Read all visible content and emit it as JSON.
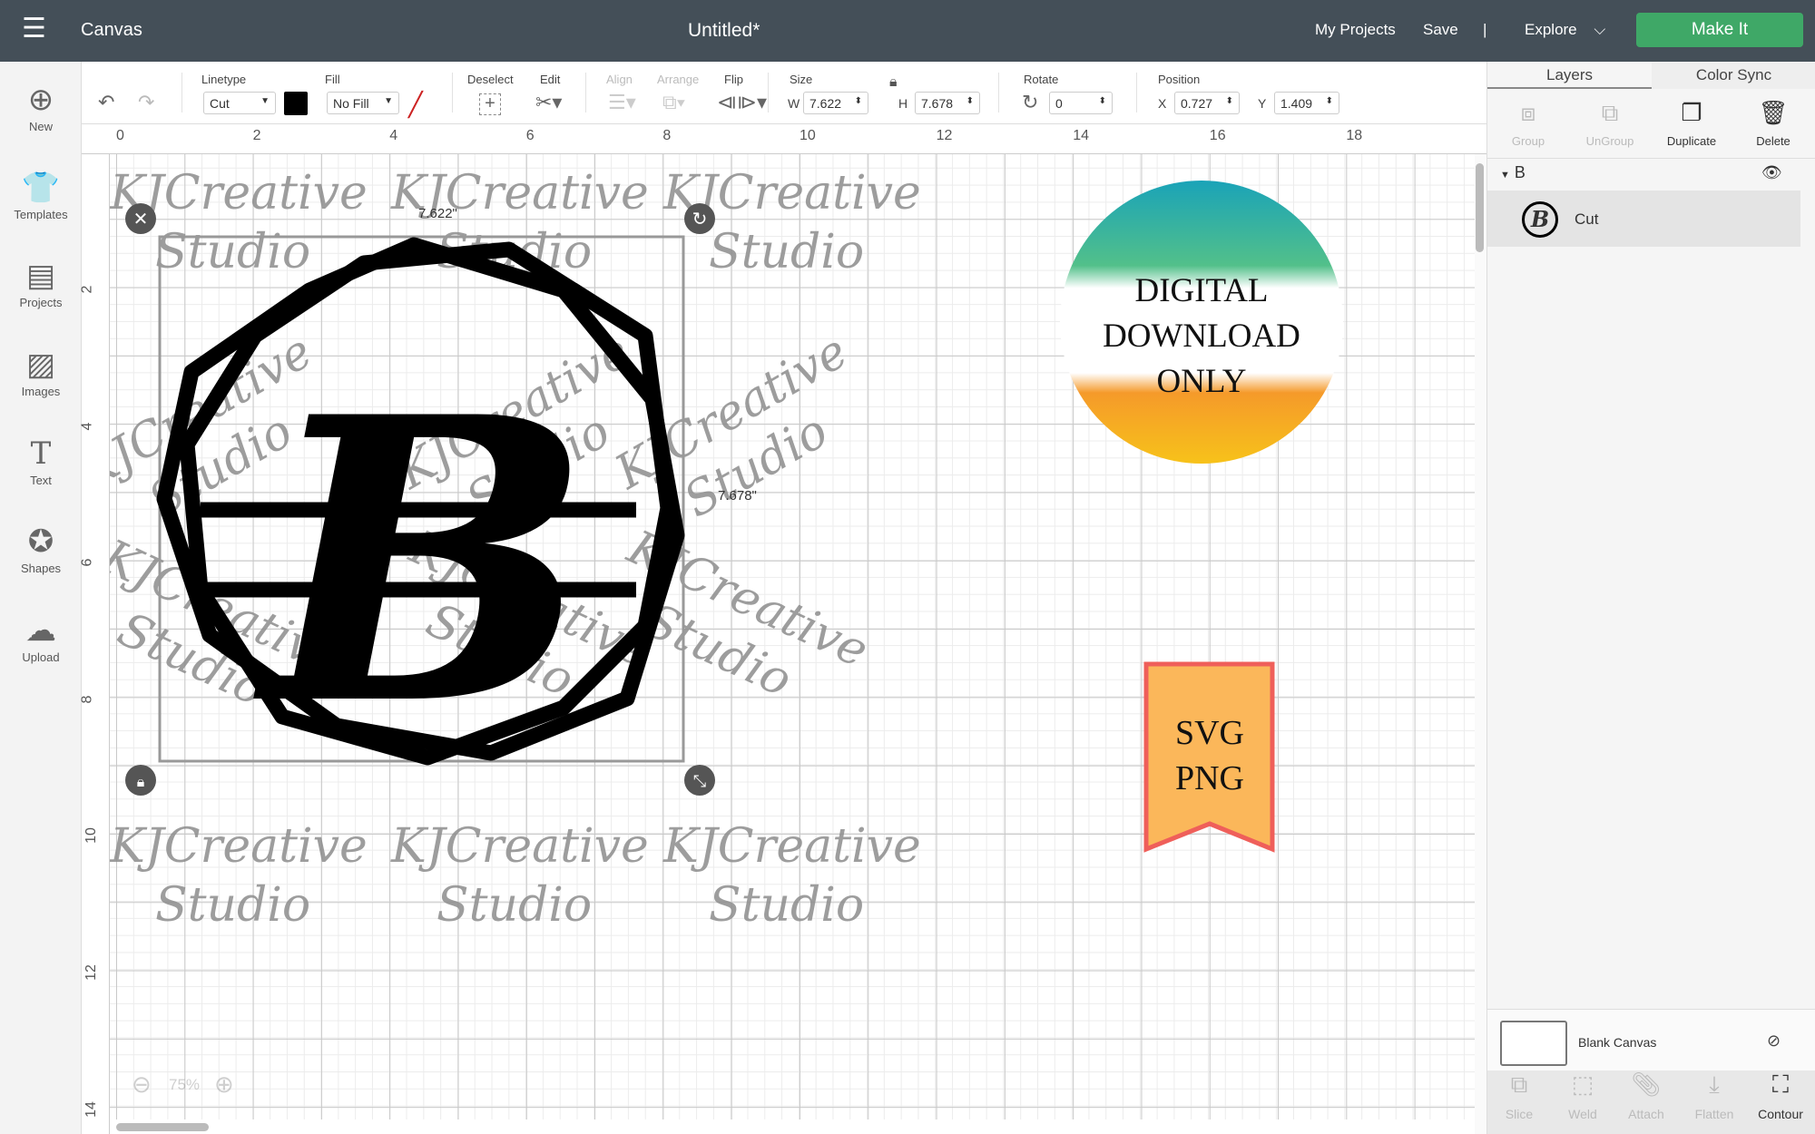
{
  "topbar": {
    "menu_icon": "hamburger-icon",
    "app": "Canvas",
    "title": "Untitled*",
    "my_projects": "My Projects",
    "save": "Save",
    "divider": "|",
    "explore": "Explore",
    "make_it": "Make It"
  },
  "sidebar": [
    {
      "label": "New",
      "icon": "plus-circle-icon"
    },
    {
      "label": "Templates",
      "icon": "shirt-icon"
    },
    {
      "label": "Projects",
      "icon": "notebook-icon"
    },
    {
      "label": "Images",
      "icon": "image-icon"
    },
    {
      "label": "Text",
      "icon": "text-icon"
    },
    {
      "label": "Shapes",
      "icon": "shapes-icon"
    },
    {
      "label": "Upload",
      "icon": "cloud-upload-icon"
    }
  ],
  "toolbar": {
    "linetype_label": "Linetype",
    "linetype": "Cut",
    "linetype_color": "#000000",
    "fill_label": "Fill",
    "fill": "No Fill",
    "deselect": "Deselect",
    "edit": "Edit",
    "align": "Align",
    "arrange": "Arrange",
    "flip": "Flip",
    "size": "Size",
    "w_label": "W",
    "w": "7.622",
    "h_label": "H",
    "h": "7.678",
    "rotate": "Rotate",
    "rotate_value": "0",
    "position": "Position",
    "x_label": "X",
    "x": "0.727",
    "y_label": "Y",
    "y": "1.409"
  },
  "ruler": {
    "top": [
      "0",
      "2",
      "4",
      "6",
      "8",
      "10",
      "12",
      "14",
      "16",
      "18"
    ],
    "left": [
      "2",
      "4",
      "6",
      "8",
      "10",
      "12",
      "14"
    ]
  },
  "canvas": {
    "width_label": "7.622\"",
    "height_label": "7.678\"",
    "watermark_line1": "KJCreative",
    "watermark_line2": "Studio",
    "monogram": "B",
    "badge_lines": [
      "DIGITAL",
      "DOWNLOAD",
      "ONLY"
    ],
    "ribbon_lines": [
      "SVG",
      "PNG"
    ],
    "zoom": "75%"
  },
  "panel": {
    "tabs": [
      "Layers",
      "Color Sync"
    ],
    "actions": [
      "Group",
      "UnGroup",
      "Duplicate",
      "Delete"
    ],
    "group_name": "B",
    "layer_name": "Cut",
    "blank_canvas": "Blank Canvas",
    "tools": [
      "Slice",
      "Weld",
      "Attach",
      "Flatten",
      "Contour"
    ]
  },
  "colors": {
    "topbar": "#444f58",
    "make_it": "#3fa867",
    "ribbon_fill": "#fbb75a",
    "ribbon_border": "#ef5f5a"
  }
}
